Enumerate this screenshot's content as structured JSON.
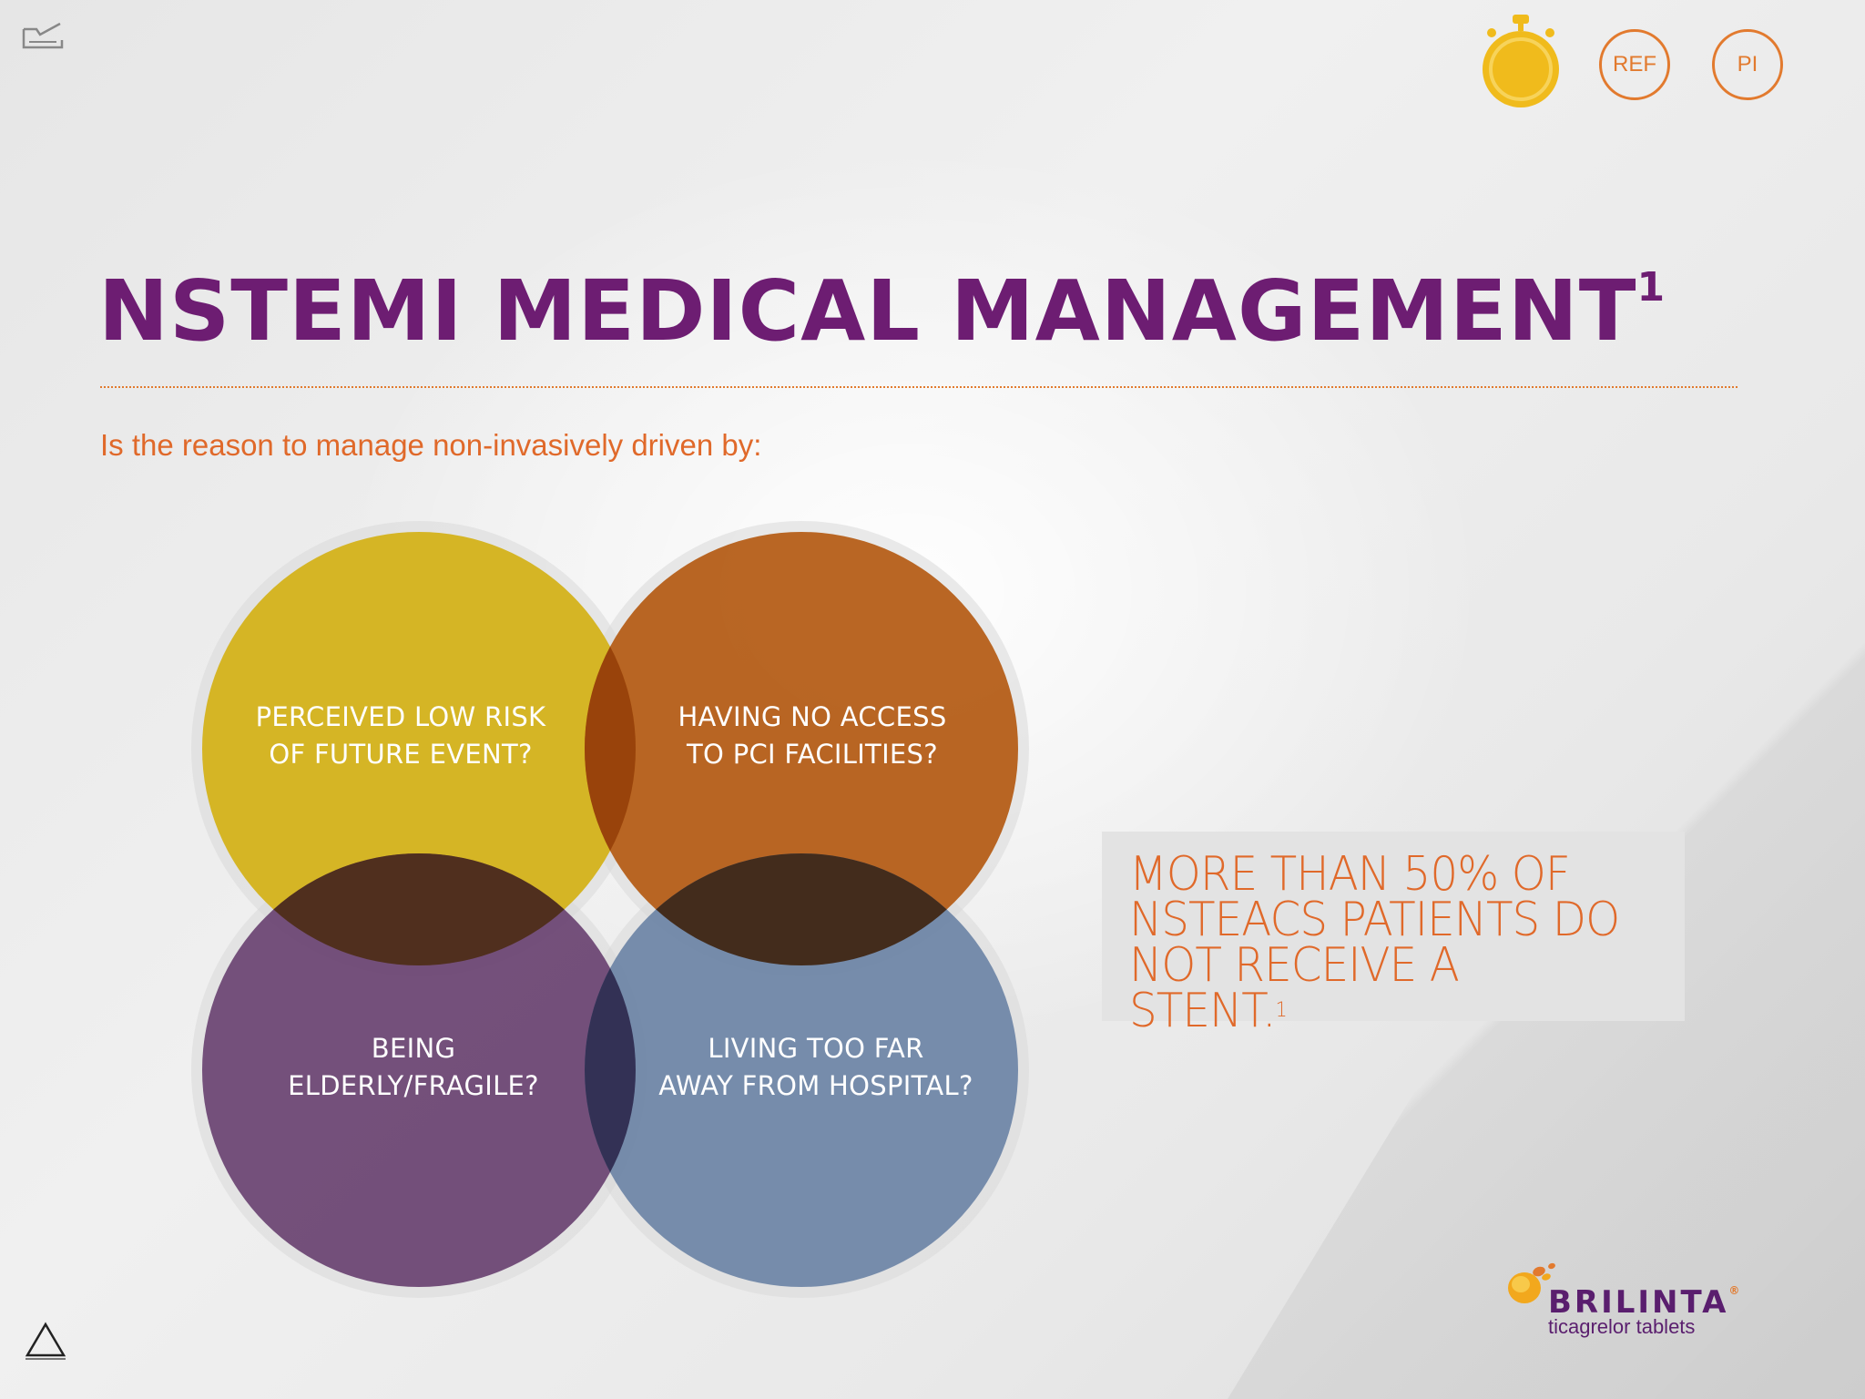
{
  "header": {
    "timer_icon": "stopwatch-icon",
    "ref_label": "REF",
    "pi_label": "PI"
  },
  "page": {
    "title": "NSTEMI MEDICAL MANAGEMENT",
    "title_superscript": "1",
    "question": "Is the reason to manage non-invasively driven by:"
  },
  "venn": {
    "items": [
      {
        "line1": "PERCEIVED LOW RISK",
        "line2": "OF FUTURE EVENT?",
        "color": "#d4b21a"
      },
      {
        "line1": "HAVING NO ACCESS",
        "line2": "TO PCI FACILITIES?",
        "color": "#b45a12"
      },
      {
        "line1": "BEING",
        "line2": "ELDERLY/FRAGILE?",
        "color": "#673f6f"
      },
      {
        "line1": "LIVING TOO FAR",
        "line2": "AWAY FROM HOSPITAL?",
        "color": "#6680a3"
      }
    ]
  },
  "stat": {
    "line1": "MORE THAN 50% OF",
    "line2": "NSTEACS PATIENTS DO",
    "line3": "NOT RECEIVE A STENT.",
    "superscript": "1"
  },
  "brand": {
    "name": "BRILINTA",
    "registered": "®",
    "tagline": "ticagrelor tablets"
  },
  "colors": {
    "title_purple": "#6d1d72",
    "accent_orange": "#e27a2e",
    "timer_yellow": "#f0bb1c"
  },
  "nav": {
    "top_left_icon": "notes-tray-icon",
    "bottom_left_icon": "triangle-menu-icon"
  }
}
